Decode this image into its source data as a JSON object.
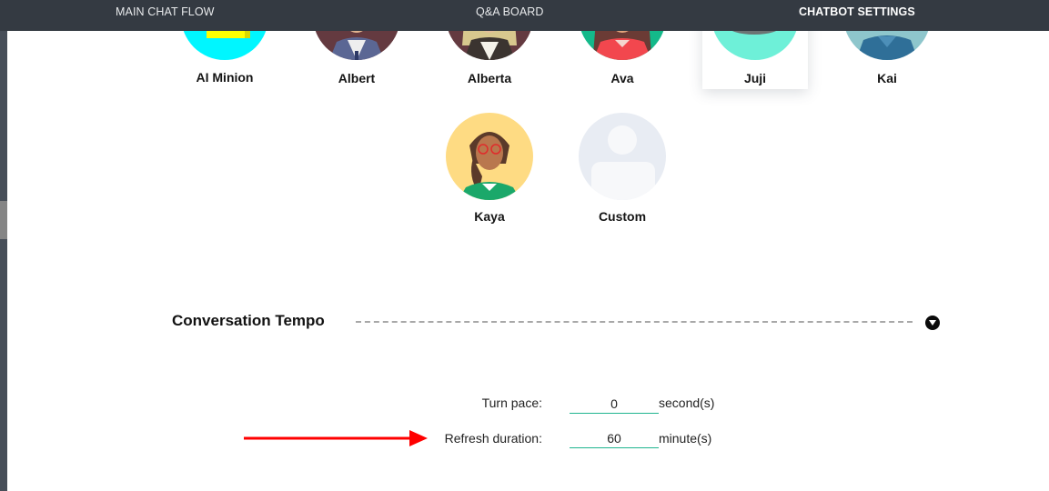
{
  "topbar": {
    "tabs": [
      {
        "label": "MAIN CHAT FLOW",
        "active": false
      },
      {
        "label": "Q&A BOARD",
        "active": false
      },
      {
        "label": "CHATBOT SETTINGS",
        "active": true
      }
    ]
  },
  "avatars": {
    "selected": "Juji",
    "items": [
      {
        "name": "AI Minion",
        "icon": "minion-avatar"
      },
      {
        "name": "Albert",
        "icon": "man-avatar"
      },
      {
        "name": "Alberta",
        "icon": "woman-blonde-avatar"
      },
      {
        "name": "Ava",
        "icon": "woman-avatar"
      },
      {
        "name": "Juji",
        "icon": "robot-avatar"
      },
      {
        "name": "Kai",
        "icon": "man-avatar"
      },
      {
        "name": "Kaya",
        "icon": "woman-glasses-avatar"
      },
      {
        "name": "Custom",
        "icon": "placeholder-person-avatar"
      }
    ]
  },
  "tempo": {
    "title": "Conversation Tempo",
    "toggle_icon": "chevron-down-circle-icon",
    "fields": [
      {
        "label": "Turn pace:",
        "value": "0",
        "unit": "second(s)"
      },
      {
        "label": "Refresh duration:",
        "value": "60",
        "unit": "minute(s)"
      }
    ]
  },
  "annotation": {
    "type": "arrow",
    "color": "#ff0000",
    "points_to": "Refresh duration"
  },
  "colors": {
    "topbar": "#343a42",
    "input_underline": "#1fb48f",
    "arrow": "#ff0000"
  }
}
